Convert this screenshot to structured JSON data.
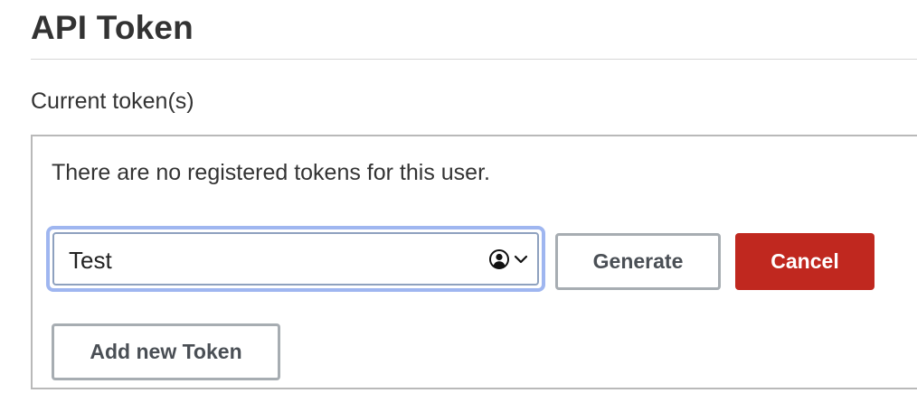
{
  "page": {
    "title": "API Token",
    "section_label": "Current token(s)"
  },
  "token_panel": {
    "empty_message": "There are no registered tokens for this user.",
    "token_name_input": {
      "value": "Test",
      "icons": [
        "user-circle-icon",
        "chevron-down-icon"
      ]
    },
    "generate_label": "Generate",
    "cancel_label": "Cancel",
    "add_label": "Add new Token"
  },
  "colors": {
    "focus_ring": "#9fb6f0",
    "cancel_background": "#c0281f",
    "secondary_border": "#a7adb2",
    "text": "#333333"
  }
}
